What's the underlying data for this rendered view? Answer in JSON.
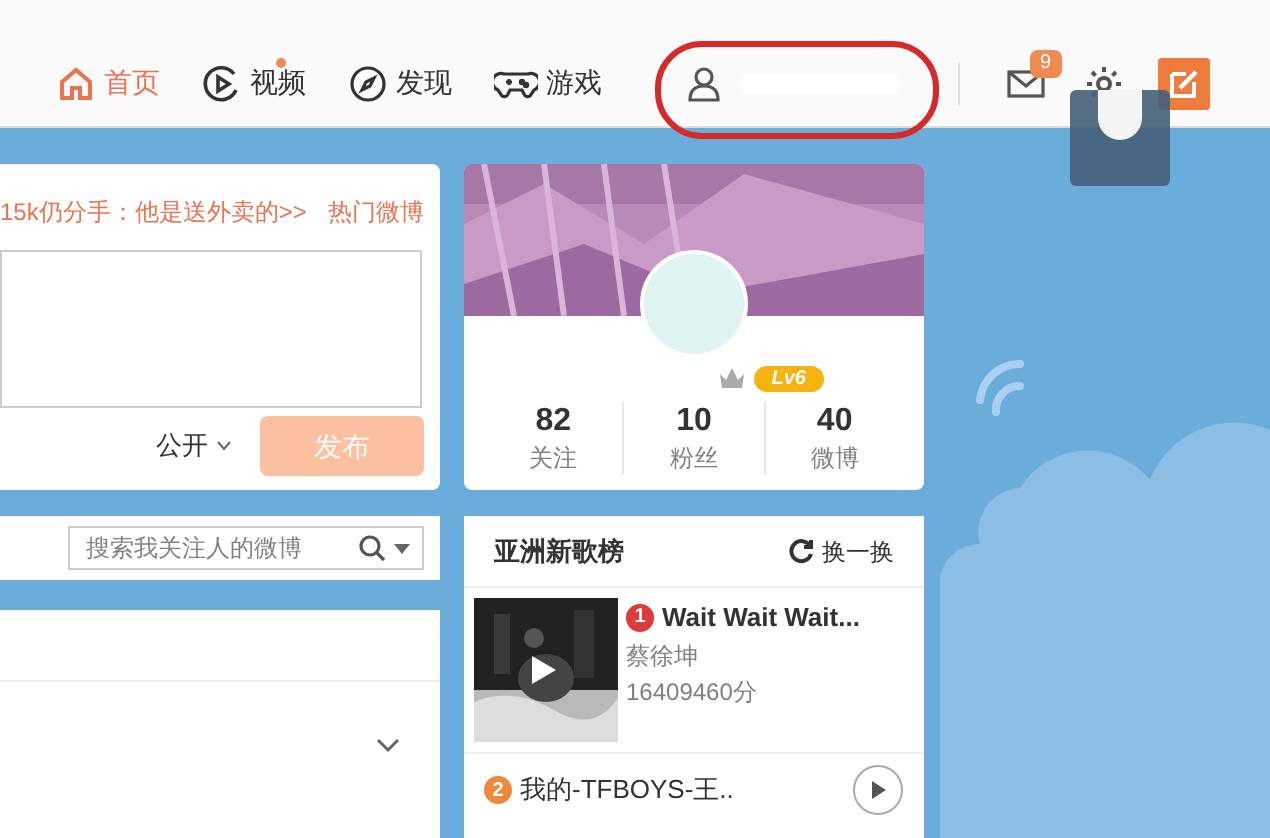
{
  "nav": {
    "items": [
      {
        "label": "首页",
        "kind": "home",
        "selected": true,
        "dot": false
      },
      {
        "label": "视频",
        "kind": "video",
        "selected": false,
        "dot": true
      },
      {
        "label": "发现",
        "kind": "discover",
        "selected": false,
        "dot": false
      },
      {
        "label": "游戏",
        "kind": "game",
        "selected": false,
        "dot": false
      }
    ],
    "messages_badge": "9"
  },
  "composer": {
    "hot_text": "15k仍分手：他是送外卖的>>",
    "hot_link": "热门微博",
    "visibility": "公开",
    "post_button": "发布"
  },
  "profile": {
    "level": "Lv6",
    "stats": [
      {
        "value": "82",
        "label": "关注"
      },
      {
        "value": "10",
        "label": "粉丝"
      },
      {
        "value": "40",
        "label": "微博"
      }
    ]
  },
  "search": {
    "placeholder": "搜索我关注人的微博"
  },
  "chart": {
    "title": "亚洲新歌榜",
    "refresh": "换一换",
    "songs": [
      {
        "rank": "1",
        "title": "Wait Wait Wait...",
        "artist": "蔡徐坤",
        "score": "16409460分",
        "color": "#e03a3a",
        "kind": "featured"
      },
      {
        "rank": "2",
        "title": "我的-TFBOYS-王..",
        "color": "#f0883a",
        "kind": "compact"
      }
    ]
  }
}
